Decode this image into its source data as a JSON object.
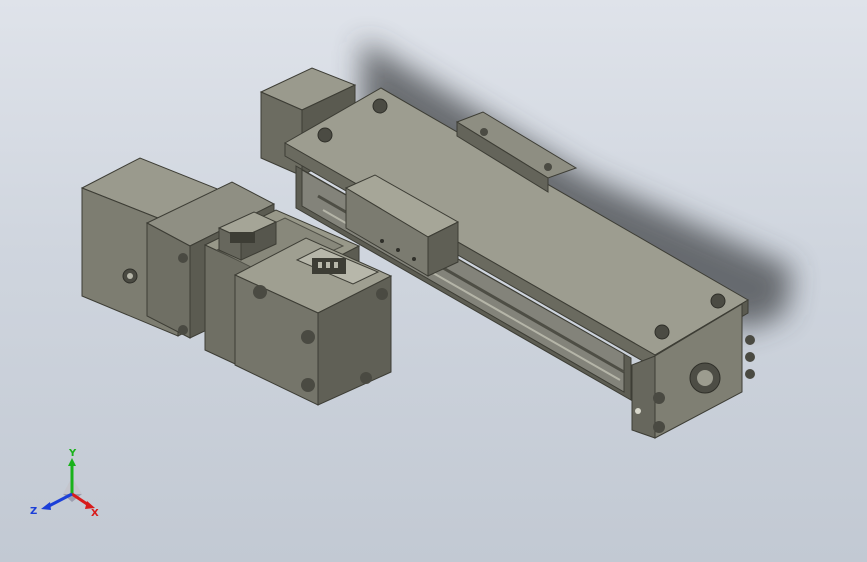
{
  "viewport": {
    "background_top": "#dfe3ea",
    "background_bottom": "#c2c9d3",
    "model_color": "#76766a",
    "model_dark": "#55554b",
    "model_light": "#9a9a8d"
  },
  "triad": {
    "x_label": "X",
    "y_label": "Y",
    "z_label": "Z",
    "x_color": "#d81b1b",
    "y_color": "#19b21b",
    "z_color": "#1b3fd8"
  }
}
